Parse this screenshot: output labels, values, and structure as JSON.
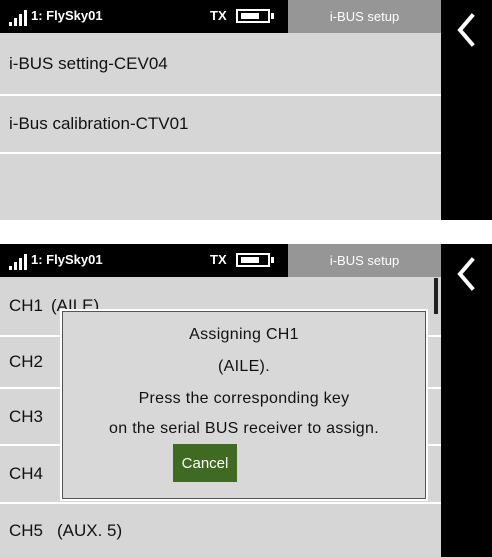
{
  "colors": {
    "status_bar": "#000000",
    "title_tab": "#969696",
    "background": "#d6d6d6",
    "cancel_button": "#3f6a22",
    "sidebar": "#000000"
  },
  "status": {
    "model": "1: FlySky01",
    "tx_label": "TX",
    "tx_battery_level": 0.75
  },
  "title": "i-BUS setup",
  "back_icon": "chevron-left-icon",
  "screen1": {
    "items": [
      {
        "label": "i-BUS setting-CEV04"
      },
      {
        "label": "i-Bus calibration-CTV01"
      }
    ]
  },
  "screen2": {
    "channels": [
      {
        "ch": "CH1",
        "name": "(AILE)"
      },
      {
        "ch": "CH2",
        "name": ""
      },
      {
        "ch": "CH3",
        "name": ""
      },
      {
        "ch": "CH4",
        "name": ""
      },
      {
        "ch": "CH5",
        "name": "(AUX. 5)"
      }
    ],
    "dialog": {
      "line1": "Assigning CH1",
      "line2": "(AILE).",
      "line3": "Press the corresponding key",
      "line4": "on the serial BUS receiver to assign.",
      "cancel": "Cancel"
    }
  }
}
